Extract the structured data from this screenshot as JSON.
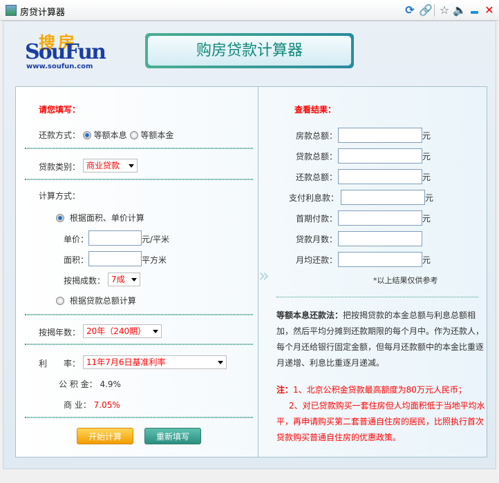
{
  "window": {
    "title": "房贷计算器",
    "icons": [
      "refresh-icon",
      "link-icon",
      "star-icon",
      "mute-icon",
      "minimize-icon",
      "close-icon"
    ]
  },
  "logo": {
    "cn": "搜房",
    "en": "SouFun",
    "url": "www.soufun.com"
  },
  "banner": "购房贷款计算器",
  "form": {
    "heading": "请您填写：",
    "repay_label": "还款方式：",
    "repay_opt1": "等额本息",
    "repay_opt2": "等额本金",
    "loan_type_label": "贷款类别：",
    "loan_type": "商业贷款",
    "calc_label": "计算方式：",
    "calc_opt1": "根据面积、单价计算",
    "price_label": "单价：",
    "price_value": "",
    "price_unit": "元/平米",
    "area_label": "面积：",
    "area_value": "",
    "area_unit": "平方米",
    "ratio_label": "按揭成数：",
    "ratio": "7成",
    "calc_opt2": "根据贷款总额计算",
    "years_label": "按揭年数：",
    "years": "20年（240期）",
    "rate_label": "利　　率：",
    "rate": "11年7月6日基准利率",
    "fund_label": "公 积 金：",
    "fund_rate": "4.9%",
    "biz_label": "商 业：",
    "biz_rate": "7.05%",
    "start": "开始计算",
    "reset": "重新填写"
  },
  "results": {
    "heading": "查看结果：",
    "rows": [
      {
        "label": "房款总额：",
        "value": "",
        "unit": "元"
      },
      {
        "label": "贷款总额：",
        "value": "",
        "unit": "元"
      },
      {
        "label": "还款总额：",
        "value": "",
        "unit": "元"
      },
      {
        "label": "支付利息款：",
        "value": "",
        "unit": "元"
      },
      {
        "label": "首期付款：",
        "value": "",
        "unit": "元"
      },
      {
        "label": "贷款月数：",
        "value": "",
        "unit": ""
      },
      {
        "label": "月均还款：",
        "value": "",
        "unit": "元"
      }
    ],
    "note": "*以上结果仅供参考",
    "desc_title": "等额本息还款法：",
    "desc": "把按揭贷款的本金总额与利息总额相加，然后平均分摊到还款期限的每个月中。作为还款人，每个月还给银行固定金额，但每月还款额中的本金比重逐月递增、利息比重逐月递减。",
    "note1_title": "注：",
    "note1": "1、北京公积金贷款最高额度为80万元人民币；",
    "note2": "2、对已贷款购买一套住房但人均面积低于当地平均水平，再申请购买第二套普通自住房的居民，比照执行首次贷款购买普通自住房的优惠政策。"
  }
}
